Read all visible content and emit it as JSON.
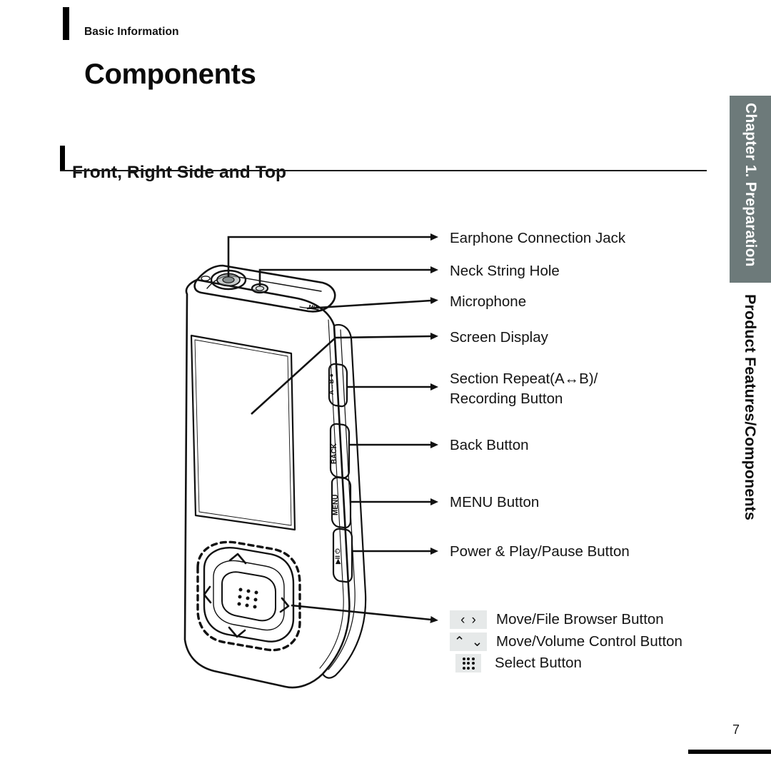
{
  "header": {
    "eyebrow": "Basic Information",
    "title": "Components"
  },
  "section": {
    "title": "Front, Right Side and Top"
  },
  "side_tab": {
    "chapter": "Chapter 1. Preparation",
    "subtitle": "Product Features/Components",
    "chapter_bg": "#6d7a7a",
    "chapter_fg": "#ffffff",
    "subtitle_fg": "#0b0b0b"
  },
  "callouts": [
    {
      "id": "earphone-connection-jack",
      "label": "Earphone Connection Jack"
    },
    {
      "id": "neck-string-hole",
      "label": "Neck String Hole"
    },
    {
      "id": "microphone",
      "label": "Microphone"
    },
    {
      "id": "screen-display",
      "label": "Screen Display"
    },
    {
      "id": "section-repeat-recording-button",
      "label_line1": "Section Repeat(A↔B)/",
      "label_line2": "Recording Button"
    },
    {
      "id": "back-button",
      "label": "Back Button"
    },
    {
      "id": "menu-button",
      "label": "MENU Button"
    },
    {
      "id": "power-play-pause-button",
      "label": "Power & Play/Pause Button"
    }
  ],
  "nav_callouts": {
    "move_file_browser": {
      "label": "Move/File Browser Button",
      "icon_left": "‹",
      "icon_right": "›"
    },
    "move_volume_control": {
      "label": "Move/Volume Control Button",
      "icon_up": "⌃",
      "icon_down": "⌄"
    },
    "select": {
      "label": "Select Button",
      "icon": "dot-grid-3x3"
    }
  },
  "device_labels": {
    "mic": "MIC",
    "ab_record": "A↔B",
    "back": "BACK",
    "menu": "MENU",
    "play_pause": "▶II"
  },
  "footer": {
    "page_number": "7"
  },
  "colors": {
    "ink": "#111111",
    "chip_bg": "#e6e9e9",
    "rule": "#1b1b1b"
  }
}
